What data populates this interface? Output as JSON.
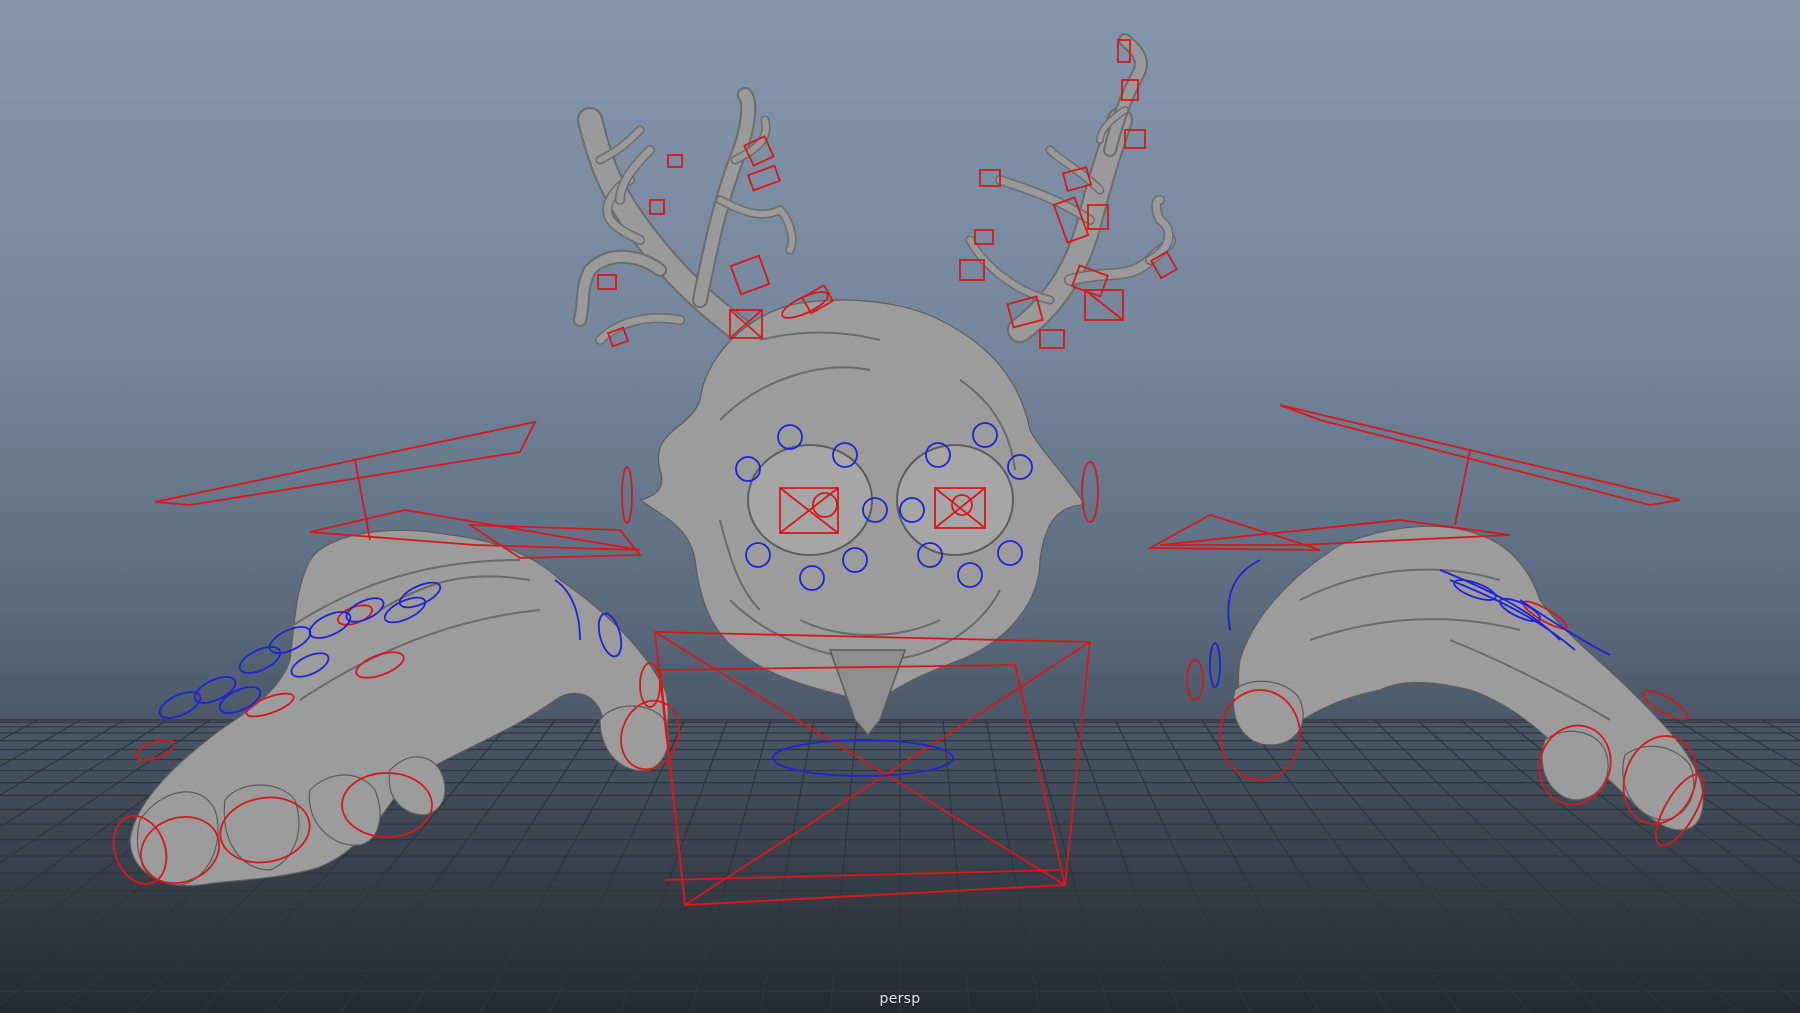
{
  "viewport": {
    "camera_label": "persp"
  },
  "colors": {
    "ik_controls": "#d81818",
    "fk_controls": "#1e22d8",
    "mesh": "#9c9c9c",
    "grid": "#2f353c"
  }
}
